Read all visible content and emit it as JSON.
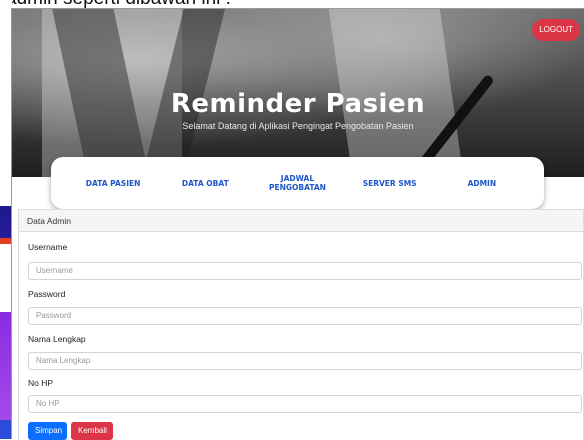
{
  "caption": {
    "text": "admin seperti dibawah ini :"
  },
  "header": {
    "logout_label": "LOGOUT",
    "title": "Reminder Pasien",
    "subtitle": "Selamat Datang di Aplikasi Pengingat Pengobatan Pasien"
  },
  "nav": {
    "items": [
      {
        "label": "DATA PASIEN"
      },
      {
        "label": "DATA OBAT"
      },
      {
        "label": "JADWAL PENGOBATAN"
      },
      {
        "label": "SERVER SMS"
      },
      {
        "label": "ADMIN"
      }
    ]
  },
  "form": {
    "card_title": "Data Admin",
    "fields": [
      {
        "label": "Username",
        "placeholder": "Username"
      },
      {
        "label": "Password",
        "placeholder": "Password"
      },
      {
        "label": "Nama Lengkap",
        "placeholder": "Nama Lengkap"
      },
      {
        "label": "No HP",
        "placeholder": "No HP"
      }
    ],
    "save_label": "Simpan",
    "back_label": "Kembali"
  },
  "colors": {
    "primary": "#0d6efd",
    "danger": "#dc3545",
    "nav_text": "#1e55c8"
  }
}
